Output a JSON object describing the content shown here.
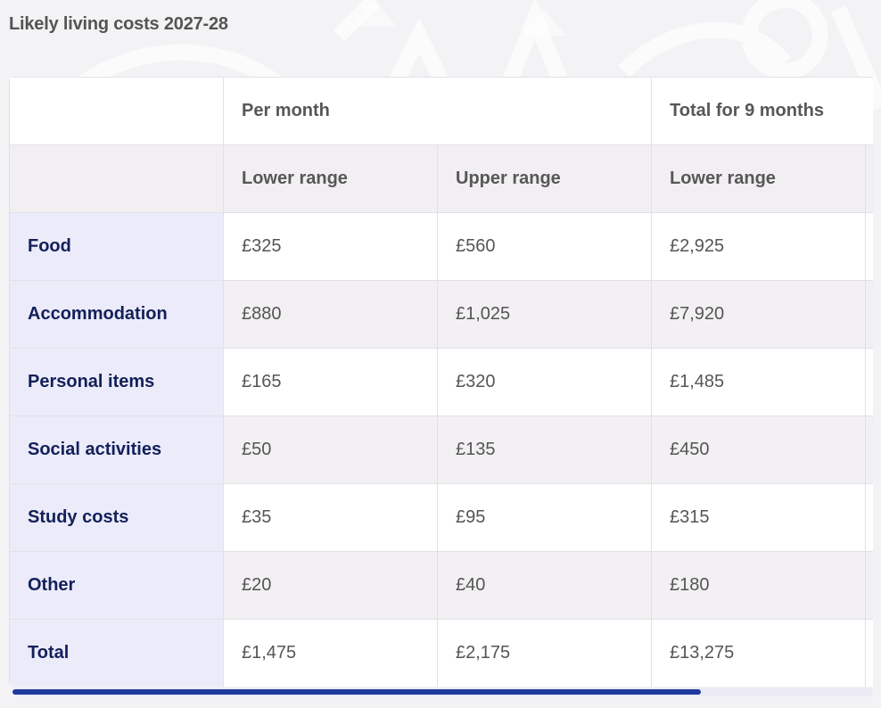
{
  "title": "Likely living costs 2027-28",
  "table": {
    "group_headers": [
      "",
      "Per month",
      "Total for 9 months"
    ],
    "sub_headers": [
      "",
      "Lower range",
      "Upper range",
      "Lower range",
      ""
    ],
    "rows": [
      {
        "label": "Food",
        "values": [
          "£325",
          "£560",
          "£2,925",
          ""
        ]
      },
      {
        "label": "Accommodation",
        "values": [
          "£880",
          "£1,025",
          "£7,920",
          ""
        ]
      },
      {
        "label": "Personal items",
        "values": [
          "£165",
          "£320",
          "£1,485",
          ""
        ]
      },
      {
        "label": "Social activities",
        "values": [
          "£50",
          "£135",
          "£450",
          ""
        ]
      },
      {
        "label": "Study costs",
        "values": [
          "£35",
          "£95",
          "£315",
          ""
        ]
      },
      {
        "label": "Other",
        "values": [
          "£20",
          "£40",
          "£180",
          ""
        ]
      },
      {
        "label": "Total",
        "values": [
          "£1,475",
          "£2,175",
          "£13,275",
          ""
        ]
      }
    ]
  },
  "scrollbar": {
    "visible_fraction": 0.8
  },
  "colors": {
    "row_label_bg": "#ecebf9",
    "row_label_text": "#12205a",
    "scrollbar_thumb": "#1f3a9e"
  }
}
